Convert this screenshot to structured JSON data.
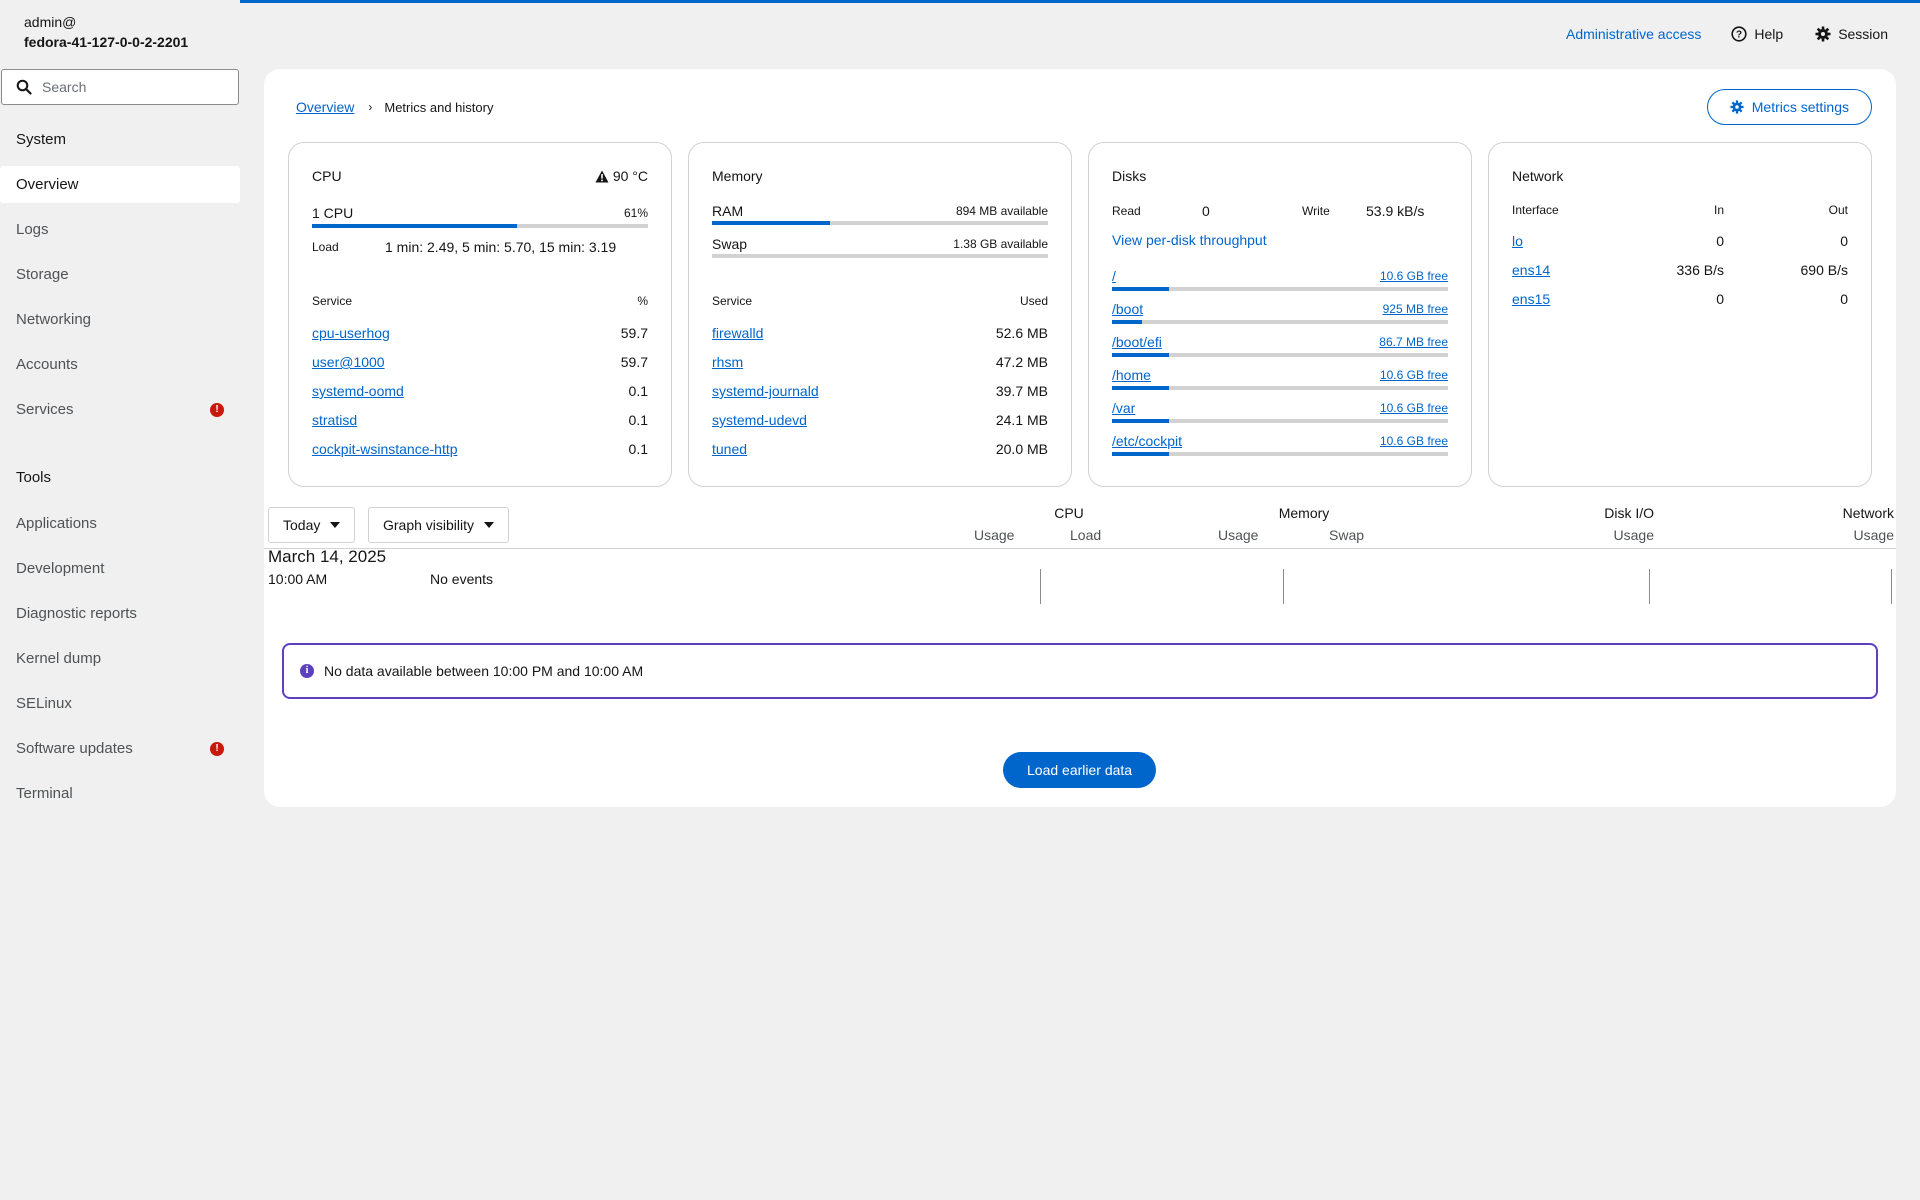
{
  "host": {
    "user": "admin@",
    "name": "fedora-41-127-0-0-2-2201"
  },
  "search": {
    "placeholder": "Search"
  },
  "sidebar": {
    "system_label": "System",
    "system_items": [
      {
        "label": "Overview",
        "active": true
      },
      {
        "label": "Logs"
      },
      {
        "label": "Storage"
      },
      {
        "label": "Networking"
      },
      {
        "label": "Accounts"
      },
      {
        "label": "Services",
        "badge": "!"
      }
    ],
    "tools_label": "Tools",
    "tools_items": [
      {
        "label": "Applications"
      },
      {
        "label": "Development"
      },
      {
        "label": "Diagnostic reports"
      },
      {
        "label": "Kernel dump"
      },
      {
        "label": "SELinux"
      },
      {
        "label": "Software updates",
        "badge": "!"
      },
      {
        "label": "Terminal"
      }
    ]
  },
  "header": {
    "admin": "Administrative access",
    "help": "Help",
    "session": "Session"
  },
  "breadcrumb": {
    "overview": "Overview",
    "separator": "›",
    "current": "Metrics and history"
  },
  "metrics_settings": "Metrics settings",
  "cpu": {
    "title": "CPU",
    "temp": "90 °C",
    "name": "1 CPU",
    "percent": "61%",
    "usage_fraction": 0.61,
    "load_label": "Load",
    "load_value": "1 min: 2.49, 5 min: 5.70, 15 min: 3.19",
    "col_service": "Service",
    "col_pct": "%",
    "services": [
      {
        "name": "cpu-userhog",
        "value": "59.7"
      },
      {
        "name": "user@1000",
        "value": "59.7"
      },
      {
        "name": "systemd-oomd",
        "value": "0.1"
      },
      {
        "name": "stratisd",
        "value": "0.1"
      },
      {
        "name": "cockpit-wsinstance-http",
        "value": "0.1"
      }
    ]
  },
  "memory": {
    "title": "Memory",
    "ram_label": "RAM",
    "ram_avail": "894 MB available",
    "ram_fraction": 0.35,
    "swap_label": "Swap",
    "swap_avail": "1.38 GB available",
    "swap_fraction": 0.0,
    "col_service": "Service",
    "col_used": "Used",
    "services": [
      {
        "name": "firewalld",
        "value": "52.6 MB"
      },
      {
        "name": "rhsm",
        "value": "47.2 MB"
      },
      {
        "name": "systemd-journald",
        "value": "39.7 MB"
      },
      {
        "name": "systemd-udevd",
        "value": "24.1 MB"
      },
      {
        "name": "tuned",
        "value": "20.0 MB"
      }
    ]
  },
  "disks": {
    "title": "Disks",
    "read_label": "Read",
    "read_value": "0",
    "write_label": "Write",
    "write_value": "53.9 kB/s",
    "per_disk": "View per-disk throughput",
    "mounts": [
      {
        "path": "/",
        "free": "10.6 GB free",
        "fraction": 0.17
      },
      {
        "path": "/boot",
        "free": "925 MB free",
        "fraction": 0.09
      },
      {
        "path": "/boot/efi",
        "free": "86.7 MB free",
        "fraction": 0.17
      },
      {
        "path": "/home",
        "free": "10.6 GB free",
        "fraction": 0.17
      },
      {
        "path": "/var",
        "free": "10.6 GB free",
        "fraction": 0.17
      },
      {
        "path": "/etc/cockpit",
        "free": "10.6 GB free",
        "fraction": 0.17
      }
    ]
  },
  "network": {
    "title": "Network",
    "col_iface": "Interface",
    "col_in": "In",
    "col_out": "Out",
    "interfaces": [
      {
        "name": "lo",
        "in": "0",
        "out": "0"
      },
      {
        "name": "ens14",
        "in": "336 B/s",
        "out": "690 B/s"
      },
      {
        "name": "ens15",
        "in": "0",
        "out": "0"
      }
    ]
  },
  "graph": {
    "period": "Today",
    "visibility": "Graph visibility",
    "cpu": "CPU",
    "memory": "Memory",
    "disk": "Disk I/O",
    "network": "Network",
    "usage": "Usage",
    "load": "Load",
    "swap": "Swap",
    "date": "March 14, 2025",
    "time": "10:00 AM",
    "events": "No events"
  },
  "alert": "No data available between 10:00 PM and 10:00 AM",
  "load_earlier": "Load earlier data"
}
